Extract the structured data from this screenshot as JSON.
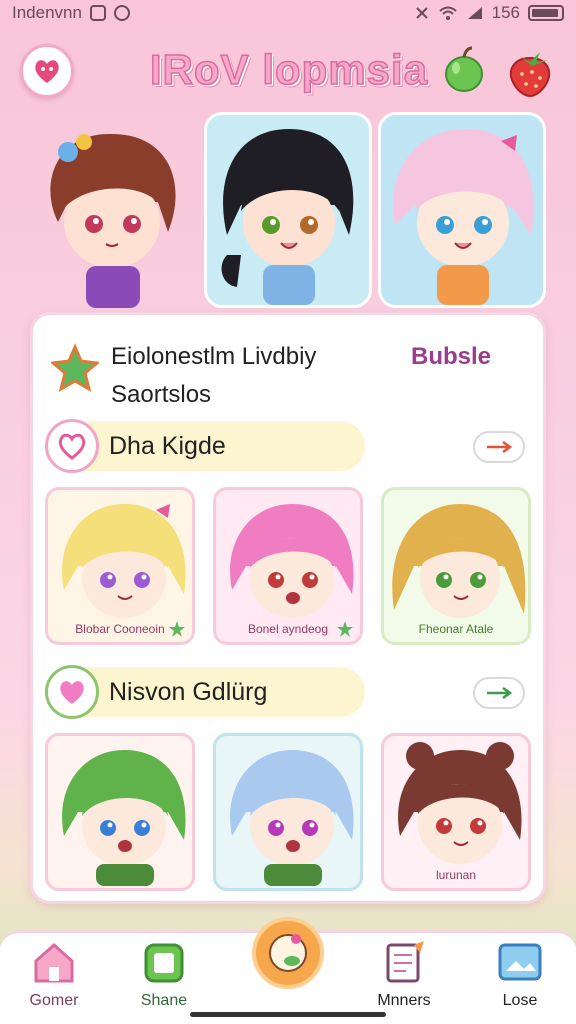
{
  "status_bar": {
    "carrier": "Indenvnn",
    "time_text": "156"
  },
  "header": {
    "app_title": "IRoV lopmsia"
  },
  "user": {
    "name": "Eiolonestlm Livdbiy",
    "subtitle": "Saortslos",
    "link": "Bubsle"
  },
  "sections": [
    {
      "title": "Dha Kigde",
      "cards": [
        {
          "label": "Blobar Cooneoin",
          "hair": "#f5df7a",
          "bg": "#fff5e6"
        },
        {
          "label": "Bonel ayndeog",
          "hair": "#f07cc1",
          "bg": "#ffeaf4"
        },
        {
          "label": "Fheonar Atale",
          "hair": "#e1b14d",
          "bg": "#f2fbe9"
        }
      ]
    },
    {
      "title": "Nisvon Gdlürg",
      "cards": [
        {
          "label": "",
          "hair": "#5fb34a",
          "bg": "#fff3f0"
        },
        {
          "label": "",
          "hair": "#a9c9ef",
          "bg": "#e8f6f8"
        },
        {
          "label": "lurunan",
          "hair": "#7a3a32",
          "bg": "#fff0f5"
        }
      ]
    }
  ],
  "bottom_nav": [
    {
      "label": "Gomer",
      "icon": "house-icon"
    },
    {
      "label": "Shane",
      "icon": "share-icon"
    },
    {
      "label": "",
      "icon": "cookie-icon"
    },
    {
      "label": "Mnners",
      "icon": "notebook-icon"
    },
    {
      "label": "Lose",
      "icon": "image-icon"
    }
  ],
  "colors": {
    "accent_pink": "#f2a4c4",
    "title_pink": "#f7a8c8",
    "link_purple": "#9b3d8f",
    "section_bg": "#fdf5cf"
  }
}
